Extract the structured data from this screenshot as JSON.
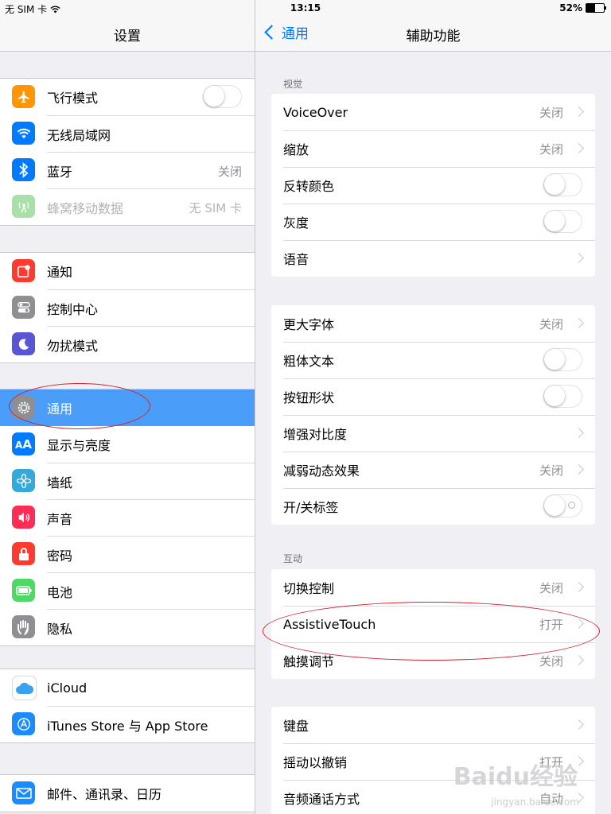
{
  "status_bar": {
    "carrier": "无 SIM 卡",
    "time": "13:15",
    "battery_level": "52%",
    "battery_fraction": 0.52
  },
  "left_pane": {
    "title": "设置",
    "groups": [
      [
        {
          "label": "飞行模式",
          "icon": "airplane-icon",
          "icon_color": "#ff9500",
          "control": "toggle",
          "toggle_on": false
        },
        {
          "label": "无线局域网",
          "icon": "wifi-icon",
          "icon_color": "#007aff",
          "control": "none"
        },
        {
          "label": "蓝牙",
          "icon": "bluetooth-icon",
          "icon_color": "#007aff",
          "value": "关闭"
        },
        {
          "label": "蜂窝移动数据",
          "icon": "cellular-icon",
          "icon_color": "#a8e0a8",
          "value": "无 SIM 卡",
          "dimmed": true
        }
      ],
      [
        {
          "label": "通知",
          "icon": "notification-icon",
          "icon_color": "#ff3b30"
        },
        {
          "label": "控制中心",
          "icon": "control-center-icon",
          "icon_color": "#8e8e93"
        },
        {
          "label": "勿扰模式",
          "icon": "moon-icon",
          "icon_color": "#5856d6"
        }
      ],
      [
        {
          "label": "通用",
          "icon": "gear-icon",
          "icon_color": "#8e8e93",
          "selected": true
        },
        {
          "label": "显示与亮度",
          "icon": "text-size-icon",
          "icon_color": "#007aff"
        },
        {
          "label": "墙纸",
          "icon": "flower-icon",
          "icon_color": "#34aadc"
        },
        {
          "label": "声音",
          "icon": "speaker-icon",
          "icon_color": "#ff2d55"
        },
        {
          "label": "密码",
          "icon": "lock-icon",
          "icon_color": "#ff3b30"
        },
        {
          "label": "电池",
          "icon": "battery-icon",
          "icon_color": "#4cd964"
        },
        {
          "label": "隐私",
          "icon": "hand-icon",
          "icon_color": "#8e8e93"
        }
      ],
      [
        {
          "label": "iCloud",
          "icon": "cloud-icon",
          "icon_color": "#ffffff"
        },
        {
          "label": "iTunes Store 与 App Store",
          "icon": "app-store-icon",
          "icon_color": "#1a8cff"
        }
      ],
      [
        {
          "label": "邮件、通讯录、日历",
          "icon": "mail-icon",
          "icon_color": "#1a8cff"
        }
      ]
    ]
  },
  "right_pane": {
    "back_label": "通用",
    "title": "辅助功能",
    "sections": [
      {
        "header": "视觉",
        "rows": [
          {
            "label": "VoiceOver",
            "value": "关闭",
            "control": "chevron"
          },
          {
            "label": "缩放",
            "value": "关闭",
            "control": "chevron"
          },
          {
            "label": "反转颜色",
            "control": "toggle",
            "toggle_on": false
          },
          {
            "label": "灰度",
            "control": "toggle",
            "toggle_on": false
          },
          {
            "label": "语音",
            "control": "chevron"
          }
        ]
      },
      {
        "header": "",
        "rows": [
          {
            "label": "更大字体",
            "value": "关闭",
            "control": "chevron"
          },
          {
            "label": "粗体文本",
            "control": "toggle",
            "toggle_on": false
          },
          {
            "label": "按钮形状",
            "control": "toggle",
            "toggle_on": false
          },
          {
            "label": "增强对比度",
            "control": "chevron"
          },
          {
            "label": "减弱动态效果",
            "value": "关闭",
            "control": "chevron"
          },
          {
            "label": "开/关标签",
            "control": "toggle",
            "toggle_on": false,
            "onoff_label": true
          }
        ]
      },
      {
        "header": "互动",
        "rows": [
          {
            "label": "切换控制",
            "value": "关闭",
            "control": "chevron"
          },
          {
            "label": "AssistiveTouch",
            "value": "打开",
            "control": "chevron"
          },
          {
            "label": "触摸调节",
            "value": "关闭",
            "control": "chevron"
          }
        ]
      },
      {
        "header": "",
        "rows": [
          {
            "label": "键盘",
            "control": "chevron"
          },
          {
            "label": "摇动以撤销",
            "value": "打开",
            "control": "chevron"
          },
          {
            "label": "音频通话方式",
            "value": "自动",
            "control": "chevron"
          }
        ]
      }
    ]
  },
  "watermark": {
    "text": "Baidu经验",
    "sub": "jingyan.baidu.com"
  }
}
